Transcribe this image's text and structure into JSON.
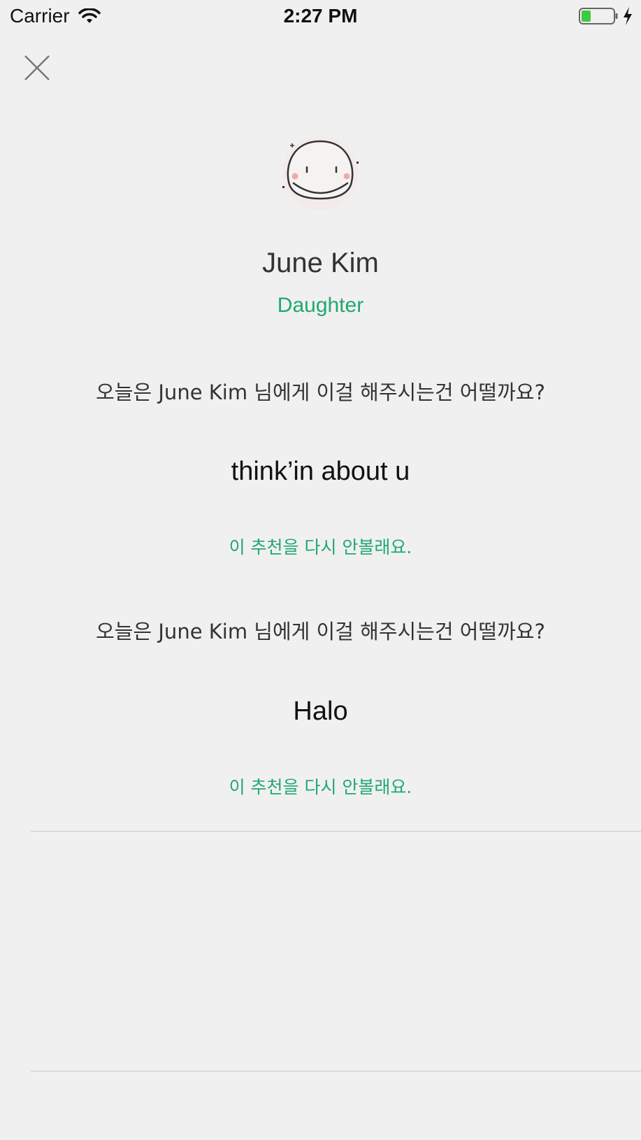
{
  "status_bar": {
    "carrier": "Carrier",
    "time": "2:27 PM",
    "wifi_icon": "wifi-icon",
    "battery_icon": "battery-icon",
    "charging_icon": "charging-bolt-icon"
  },
  "header": {
    "close_icon": "close-icon"
  },
  "profile": {
    "avatar_icon": "smiley-face-icon",
    "name": "June Kim",
    "relation": "Daughter"
  },
  "recommendations": [
    {
      "question": "오늘은 June Kim 님에게 이걸 해주시는건 어떨까요?",
      "title": "think’in about u",
      "dismiss_label": "이 추천을 다시 안볼래요."
    },
    {
      "question": "오늘은 June Kim 님에게 이걸 해주시는건 어떨까요?",
      "title": "Halo",
      "dismiss_label": "이 추천을 다시 안볼래요."
    }
  ],
  "colors": {
    "background": "#f1f0f0",
    "accent": "#1fa971",
    "text": "#333333",
    "divider": "#c9c9c9"
  }
}
